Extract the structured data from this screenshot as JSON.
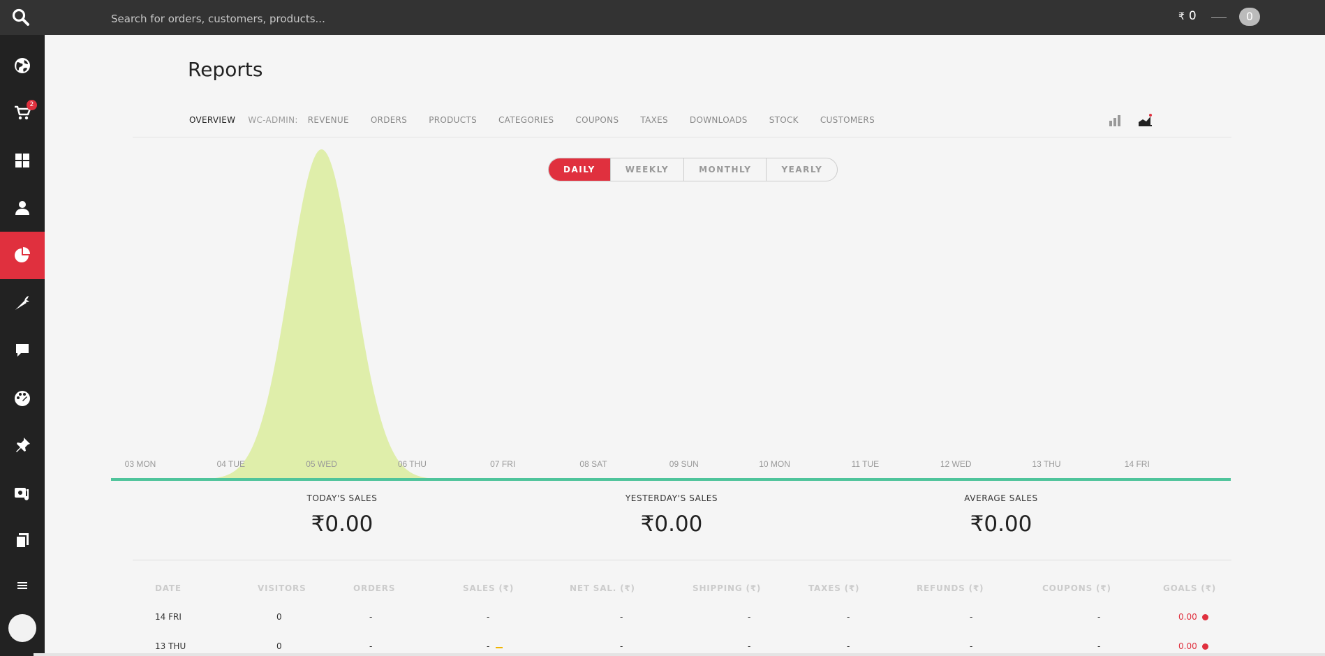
{
  "topbar": {
    "search_placeholder": "Search for orders, customers, products...",
    "currency_symbol": "₹",
    "cart_total": "0",
    "badge": "0"
  },
  "sidebar": {
    "items": [
      {
        "icon": "globe-icon"
      },
      {
        "icon": "cart-icon",
        "badge": "2"
      },
      {
        "icon": "dashboard-grid-icon"
      },
      {
        "icon": "user-icon"
      },
      {
        "icon": "pie-chart-icon",
        "active": true
      },
      {
        "icon": "carrot-icon"
      },
      {
        "icon": "comment-icon"
      },
      {
        "icon": "palette-icon"
      },
      {
        "icon": "pin-icon"
      },
      {
        "icon": "tools-icon"
      },
      {
        "icon": "copy-icon"
      },
      {
        "icon": "menu-icon"
      }
    ]
  },
  "page": {
    "title": "Reports"
  },
  "report_nav": {
    "overview": "OVERVIEW",
    "prefix": "WC-ADMIN:",
    "items": [
      "REVENUE",
      "ORDERS",
      "PRODUCTS",
      "CATEGORIES",
      "COUPONS",
      "TAXES",
      "DOWNLOADS",
      "STOCK",
      "CUSTOMERS"
    ]
  },
  "period_toggle": {
    "options": [
      "DAILY",
      "WEEKLY",
      "MONTHLY",
      "YEARLY"
    ],
    "selected": "DAILY"
  },
  "colors": {
    "accent": "#e0303e",
    "area_fill": "#dfeeaa",
    "baseline": "#4fc49b",
    "sidebar": "#222222",
    "topbar": "#333333"
  },
  "chart_data": {
    "type": "area",
    "x": [
      "03 MON",
      "04 TUE",
      "05 WED",
      "06 THU",
      "07 FRI",
      "08 SAT",
      "09 SUN",
      "10 MON",
      "11 TUE",
      "12 WED",
      "13 THU",
      "14 FRI"
    ],
    "series": [
      {
        "values": [
          0,
          0,
          1,
          0,
          0,
          0,
          0,
          0,
          0,
          0,
          0,
          0
        ]
      }
    ]
  },
  "summary": [
    {
      "label": "TODAY'S SALES",
      "value": "₹0.00"
    },
    {
      "label": "YESTERDAY'S SALES",
      "value": "₹0.00"
    },
    {
      "label": "AVERAGE SALES",
      "value": "₹0.00"
    }
  ],
  "table": {
    "headers": [
      "DATE",
      "VISITORS",
      "ORDERS",
      "SALES (₹)",
      "NET SAL. (₹)",
      "SHIPPING (₹)",
      "TAXES (₹)",
      "REFUNDS (₹)",
      "COUPONS (₹)",
      "GOALS  (₹)"
    ],
    "rows": [
      {
        "date": "14 FRI",
        "visitors": "0",
        "orders": "-",
        "sales": "-",
        "net": "-",
        "shipping": "-",
        "taxes": "-",
        "refunds": "-",
        "coupons": "-",
        "goals": "0.00"
      },
      {
        "date": "13 THU",
        "visitors": "0",
        "orders": "-",
        "sales": "-",
        "net": "-",
        "shipping": "-",
        "taxes": "-",
        "refunds": "-",
        "coupons": "-",
        "goals": "0.00"
      }
    ]
  }
}
